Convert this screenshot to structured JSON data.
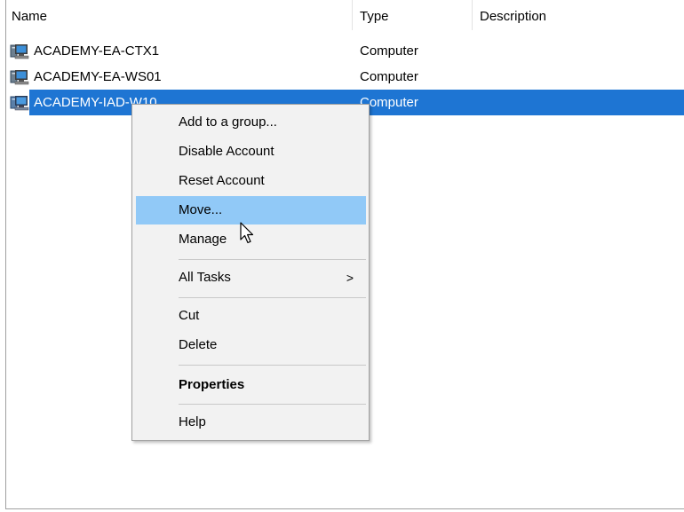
{
  "columns": {
    "name": "Name",
    "type": "Type",
    "description": "Description"
  },
  "rows": [
    {
      "name": "ACADEMY-EA-CTX1",
      "type": "Computer",
      "selected": false
    },
    {
      "name": "ACADEMY-EA-WS01",
      "type": "Computer",
      "selected": false
    },
    {
      "name": "ACADEMY-IAD-W10",
      "type": "Computer",
      "selected": true
    }
  ],
  "context_menu": {
    "items": [
      {
        "label": "Add to a group..."
      },
      {
        "label": "Disable Account"
      },
      {
        "label": "Reset Account"
      },
      {
        "label": "Move...",
        "highlighted": true
      },
      {
        "label": "Manage"
      },
      {
        "label": "All Tasks",
        "submenu_arrow": ">"
      },
      {
        "label": "Cut"
      },
      {
        "label": "Delete"
      },
      {
        "label": "Properties",
        "bold": true
      },
      {
        "label": "Help"
      }
    ]
  },
  "colors": {
    "selection": "#1e75d3",
    "menu_hover": "#91c9f7",
    "menu_bg": "#f2f2f2"
  },
  "icons": {
    "computer": "computer-icon",
    "cursor": "mouse-pointer-icon"
  }
}
